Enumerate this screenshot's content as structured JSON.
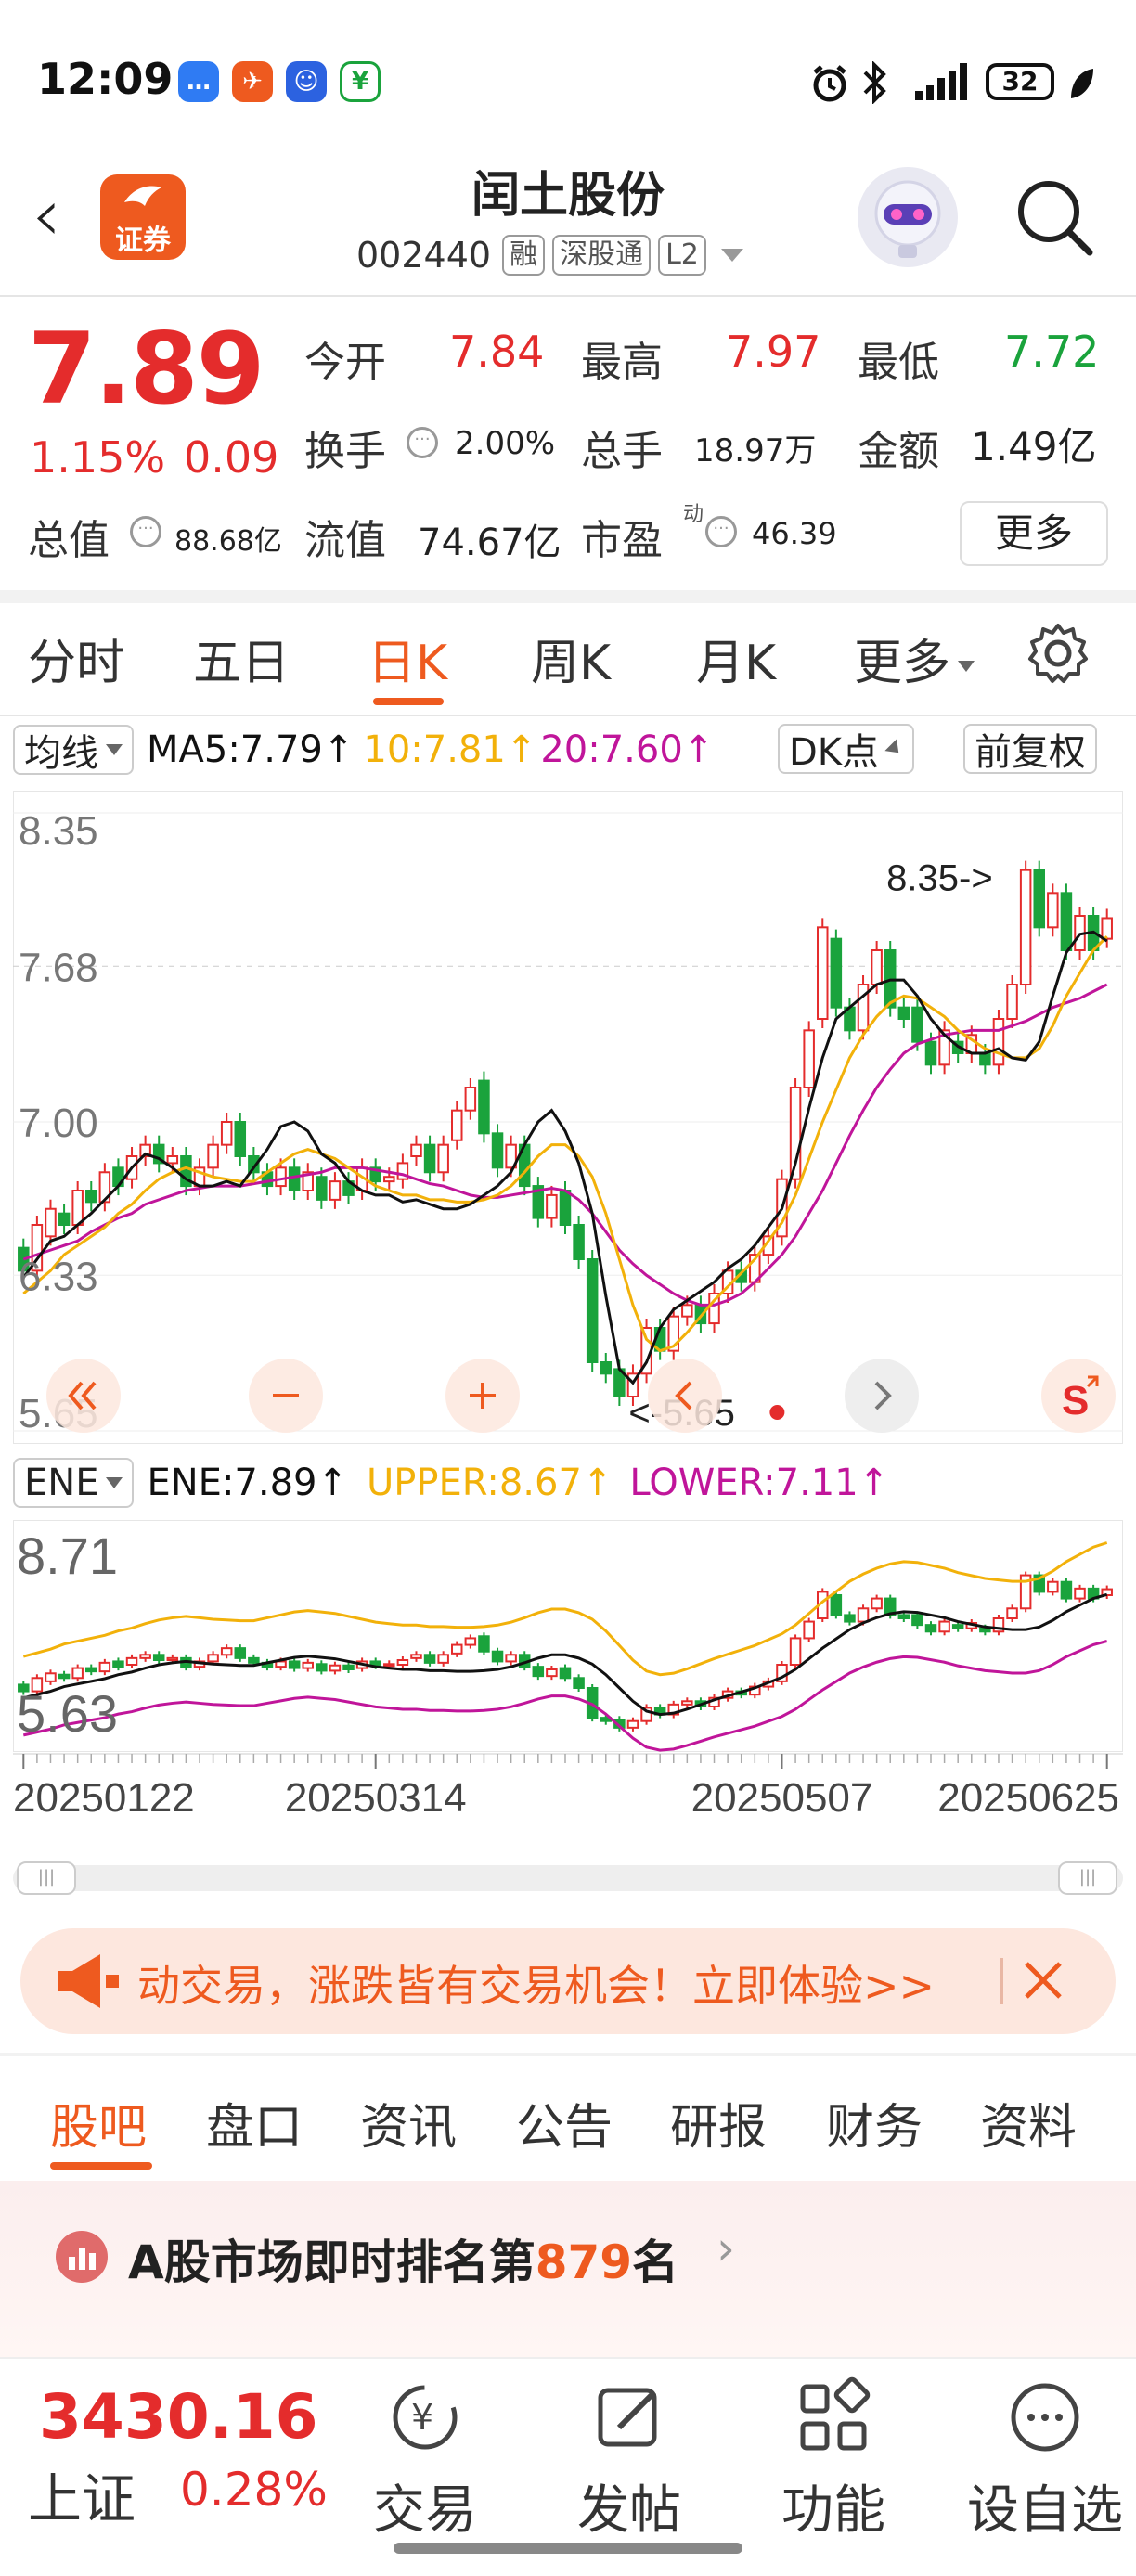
{
  "status_bar": {
    "time": "12:09",
    "battery": "32",
    "icons": [
      "message-icon",
      "app-icon",
      "contact-icon",
      "wechat-pay-icon",
      "alarm-icon",
      "bluetooth-icon",
      "signal-icon",
      "battery-icon",
      "leaf-icon"
    ]
  },
  "header": {
    "app_badge": "证券",
    "stock_name": "闰土股份",
    "stock_code": "002440",
    "tags": [
      "融",
      "深股通",
      "L2"
    ]
  },
  "quote": {
    "price": "7.89",
    "change_pct": "1.15%",
    "change_amt": "0.09",
    "fields": {
      "open_label": "今开",
      "open": "7.84",
      "high_label": "最高",
      "high": "7.97",
      "low_label": "最低",
      "low": "7.72",
      "turnover_label": "换手",
      "turnover": "2.00%",
      "volume_label": "总手",
      "volume": "18.97万",
      "amount_label": "金额",
      "amount": "1.49亿",
      "mktcap_label": "总值",
      "mktcap": "88.68亿",
      "float_label": "流值",
      "float": "74.67亿",
      "pe_label": "市盈",
      "pe_sup": "动",
      "pe": "46.39"
    },
    "more_label": "更多"
  },
  "period_tabs": {
    "items": [
      "分时",
      "五日",
      "日K",
      "周K",
      "月K",
      "更多"
    ],
    "active": "日K"
  },
  "kline_header": {
    "selector": "均线",
    "ma5": "MA5:7.79↑",
    "ma10": "10:7.81↑",
    "ma20": "20:7.60↑",
    "dk_label": "DK点",
    "adjust_label": "前复权"
  },
  "colors": {
    "up": "#e42c2c",
    "down": "#1aa33c",
    "accent": "#ee5a1f",
    "ma5": "#111111",
    "ma10": "#f2b10a",
    "ma20": "#c0159a"
  },
  "chart_data": {
    "type": "candlestick",
    "y_ticks": [
      "8.35",
      "7.68",
      "7.00",
      "6.33",
      "5.65"
    ],
    "ylim": [
      5.65,
      8.35
    ],
    "max_annotation": "8.35->",
    "min_annotation": "<-5.65",
    "ma5": [
      6.32,
      6.4,
      6.48,
      6.5,
      6.55,
      6.6,
      6.66,
      6.72,
      6.8,
      6.86,
      6.84,
      6.8,
      6.75,
      6.72,
      6.72,
      6.74,
      6.72,
      6.8,
      6.88,
      6.98,
      7.0,
      6.96,
      6.86,
      6.82,
      6.74,
      6.7,
      6.68,
      6.68,
      6.65,
      6.66,
      6.64,
      6.62,
      6.62,
      6.64,
      6.68,
      6.72,
      6.78,
      6.9,
      7.0,
      7.05,
      6.96,
      6.82,
      6.6,
      6.24,
      5.92,
      5.86,
      5.95,
      6.1,
      6.18,
      6.22,
      6.26,
      6.3,
      6.36,
      6.4,
      6.46,
      6.54,
      6.62,
      6.82,
      7.06,
      7.28,
      7.45,
      7.5,
      7.55,
      7.6,
      7.62,
      7.62,
      7.55,
      7.45,
      7.38,
      7.33,
      7.3,
      7.3,
      7.32,
      7.28,
      7.27,
      7.35,
      7.55,
      7.74,
      7.82,
      7.83,
      7.79
    ],
    "ma10": [
      6.25,
      6.3,
      6.35,
      6.42,
      6.46,
      6.5,
      6.54,
      6.6,
      6.64,
      6.7,
      6.75,
      6.78,
      6.8,
      6.78,
      6.76,
      6.75,
      6.74,
      6.74,
      6.78,
      6.82,
      6.86,
      6.88,
      6.86,
      6.84,
      6.8,
      6.76,
      6.72,
      6.7,
      6.68,
      6.68,
      6.66,
      6.66,
      6.65,
      6.65,
      6.66,
      6.68,
      6.72,
      6.78,
      6.85,
      6.9,
      6.9,
      6.85,
      6.76,
      6.6,
      6.4,
      6.2,
      6.05,
      6.0,
      6.02,
      6.08,
      6.15,
      6.22,
      6.28,
      6.34,
      6.4,
      6.48,
      6.56,
      6.68,
      6.84,
      7.0,
      7.14,
      7.28,
      7.38,
      7.46,
      7.52,
      7.55,
      7.54,
      7.5,
      7.46,
      7.4,
      7.36,
      7.32,
      7.3,
      7.28,
      7.28,
      7.32,
      7.42,
      7.55,
      7.65,
      7.75,
      7.81
    ],
    "ma20": [
      6.4,
      6.42,
      6.44,
      6.46,
      6.48,
      6.52,
      6.55,
      6.58,
      6.6,
      6.64,
      6.66,
      6.68,
      6.7,
      6.71,
      6.72,
      6.72,
      6.72,
      6.73,
      6.74,
      6.75,
      6.76,
      6.77,
      6.78,
      6.8,
      6.8,
      6.8,
      6.79,
      6.78,
      6.77,
      6.75,
      6.73,
      6.72,
      6.7,
      6.68,
      6.67,
      6.67,
      6.68,
      6.69,
      6.7,
      6.71,
      6.7,
      6.66,
      6.6,
      6.52,
      6.44,
      6.38,
      6.33,
      6.29,
      6.25,
      6.22,
      6.2,
      6.2,
      6.22,
      6.25,
      6.3,
      6.36,
      6.42,
      6.5,
      6.6,
      6.7,
      6.82,
      6.94,
      7.05,
      7.15,
      7.23,
      7.3,
      7.34,
      7.36,
      7.38,
      7.39,
      7.4,
      7.4,
      7.4,
      7.42,
      7.44,
      7.47,
      7.5,
      7.52,
      7.54,
      7.57,
      7.6
    ],
    "candles": [
      [
        6.45,
        6.35
      ],
      [
        6.35,
        6.55
      ],
      [
        6.5,
        6.62
      ],
      [
        6.6,
        6.55
      ],
      [
        6.55,
        6.7
      ],
      [
        6.7,
        6.65
      ],
      [
        6.65,
        6.78
      ],
      [
        6.8,
        6.72
      ],
      [
        6.75,
        6.85
      ],
      [
        6.85,
        6.9
      ],
      [
        6.9,
        6.82
      ],
      [
        6.82,
        6.85
      ],
      [
        6.85,
        6.72
      ],
      [
        6.72,
        6.8
      ],
      [
        6.8,
        6.9
      ],
      [
        6.9,
        7.0
      ],
      [
        7.0,
        6.85
      ],
      [
        6.85,
        6.78
      ],
      [
        6.78,
        6.72
      ],
      [
        6.72,
        6.8
      ],
      [
        6.8,
        6.7
      ],
      [
        6.7,
        6.78
      ],
      [
        6.76,
        6.66
      ],
      [
        6.66,
        6.74
      ],
      [
        6.74,
        6.68
      ],
      [
        6.7,
        6.8
      ],
      [
        6.8,
        6.74
      ],
      [
        6.74,
        6.76
      ],
      [
        6.75,
        6.82
      ],
      [
        6.85,
        6.9
      ],
      [
        6.9,
        6.78
      ],
      [
        6.78,
        6.9
      ],
      [
        6.92,
        7.05
      ],
      [
        7.05,
        7.15
      ],
      [
        7.18,
        6.95
      ],
      [
        6.95,
        6.8
      ],
      [
        6.8,
        6.9
      ],
      [
        6.9,
        6.72
      ],
      [
        6.72,
        6.58
      ],
      [
        6.58,
        6.68
      ],
      [
        6.7,
        6.55
      ],
      [
        6.55,
        6.4
      ],
      [
        6.4,
        5.95
      ],
      [
        5.95,
        5.9
      ],
      [
        5.92,
        5.8
      ],
      [
        5.8,
        5.9
      ],
      [
        5.9,
        6.1
      ],
      [
        6.1,
        6.0
      ],
      [
        6.0,
        6.15
      ],
      [
        6.15,
        6.2
      ],
      [
        6.2,
        6.12
      ],
      [
        6.12,
        6.25
      ],
      [
        6.25,
        6.35
      ],
      [
        6.35,
        6.3
      ],
      [
        6.3,
        6.42
      ],
      [
        6.42,
        6.5
      ],
      [
        6.5,
        6.75
      ],
      [
        6.75,
        7.15
      ],
      [
        7.15,
        7.4
      ],
      [
        7.45,
        7.85
      ],
      [
        7.8,
        7.5
      ],
      [
        7.5,
        7.4
      ],
      [
        7.4,
        7.6
      ],
      [
        7.6,
        7.75
      ],
      [
        7.75,
        7.5
      ],
      [
        7.5,
        7.45
      ],
      [
        7.5,
        7.35
      ],
      [
        7.35,
        7.25
      ],
      [
        7.25,
        7.4
      ],
      [
        7.35,
        7.3
      ],
      [
        7.3,
        7.38
      ],
      [
        7.3,
        7.25
      ],
      [
        7.25,
        7.45
      ],
      [
        7.45,
        7.6
      ],
      [
        7.6,
        8.1
      ],
      [
        8.1,
        7.85
      ],
      [
        7.85,
        8.0
      ],
      [
        8.0,
        7.75
      ],
      [
        7.75,
        7.9
      ],
      [
        7.9,
        7.75
      ],
      [
        7.8,
        7.89
      ]
    ],
    "x_ticks": [
      "20250122",
      "20250314",
      "20250507",
      "20250625"
    ],
    "controls": [
      "rewind-icon",
      "zoom-out-icon",
      "zoom-in-icon",
      "prev-icon",
      "next-icon",
      "screen-icon"
    ]
  },
  "ene_panel": {
    "selector": "ENE",
    "ene": "ENE:7.89↑",
    "upper": "UPPER:8.67↑",
    "lower": "LOWER:7.11↑",
    "y_top": "8.71",
    "y_bottom": "5.63"
  },
  "banner": {
    "text": "动交易，涨跌皆有交易机会！立即体验>>"
  },
  "section_tabs": {
    "items": [
      "股吧",
      "盘口",
      "资讯",
      "公告",
      "研报",
      "财务",
      "资料"
    ],
    "active": "股吧"
  },
  "rank": {
    "prefix": "A股市场即时排名第",
    "number": "879",
    "suffix": "名"
  },
  "bottom_nav": {
    "index_value": "3430.16",
    "index_name": "上证",
    "index_pct": "0.28%",
    "items": [
      "交易",
      "发帖",
      "功能",
      "设自选"
    ]
  }
}
